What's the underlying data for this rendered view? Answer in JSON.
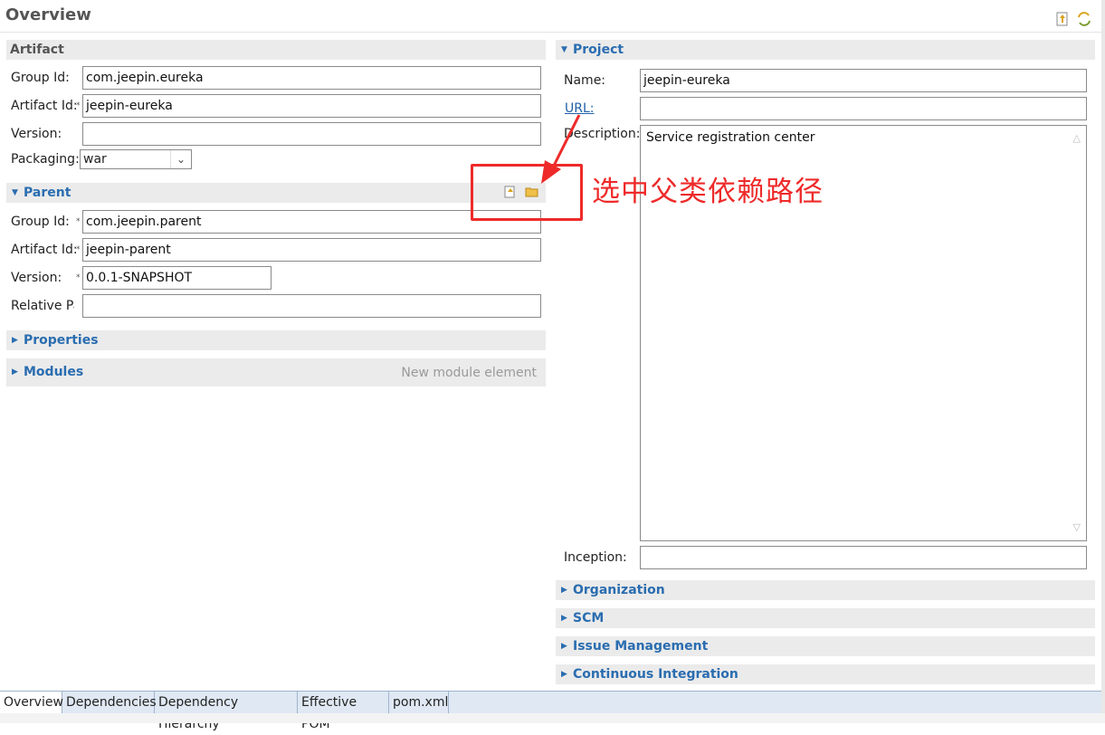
{
  "editor": {
    "title": "Overview",
    "toolbar": {
      "icon1": "parent-pom-icon",
      "icon2": "sync-icon"
    }
  },
  "artifact": {
    "header": "Artifact",
    "group_id_label": "Group Id:",
    "group_id_value": "com.jeepin.eureka",
    "artifact_id_label": "Artifact Id:",
    "artifact_id_value": "jeepin-eureka",
    "version_label": "Version:",
    "version_value": "",
    "packaging_label": "Packaging:",
    "packaging_value": "war"
  },
  "parent": {
    "header": "Parent",
    "group_id_label": "Group Id:",
    "group_id_value": "com.jeepin.parent",
    "artifact_id_label": "Artifact Id:",
    "artifact_id_value": "jeepin-parent",
    "version_label": "Version:",
    "version_value": "0.0.1-SNAPSHOT",
    "relative_path_label": "Relative Pa",
    "relative_path_value": ""
  },
  "properties": {
    "header": "Properties"
  },
  "modules": {
    "header": "Modules",
    "hint": "New module element"
  },
  "project": {
    "header": "Project",
    "name_label": "Name:",
    "name_value": "jeepin-eureka",
    "url_label": "URL:",
    "url_value": "",
    "description_label": "Description:",
    "description_value": "Service registration center",
    "inception_label": "Inception:",
    "inception_value": ""
  },
  "collapsed_sections": [
    "Organization",
    "SCM",
    "Issue Management",
    "Continuous Integration"
  ],
  "annotation": {
    "text": "选中父类依赖路径",
    "color": "#ee2a2a"
  },
  "tabs": [
    "Overview",
    "Dependencies",
    "Dependency Hierarchy",
    "Effective POM",
    "pom.xml"
  ],
  "active_tab": "Overview",
  "colors": {
    "accent": "#2a6db0",
    "section_bg": "#ebebeb",
    "tab_bar": "#dfe8f3"
  }
}
